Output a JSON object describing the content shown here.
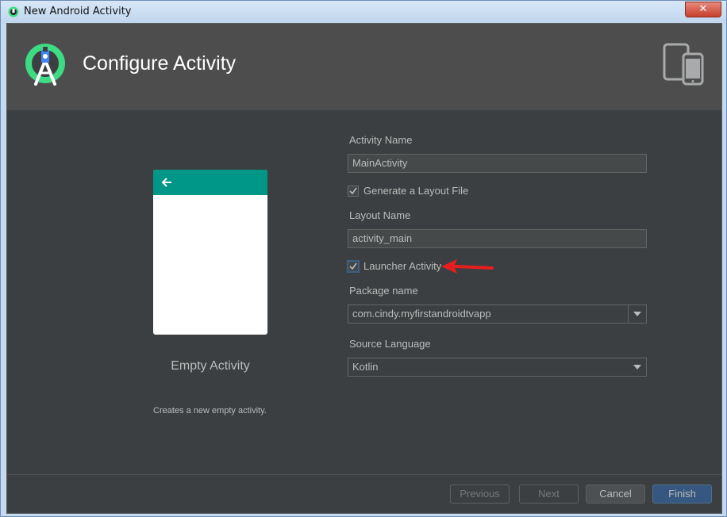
{
  "window": {
    "title": "New Android Activity",
    "close_label": "✕"
  },
  "header": {
    "title": "Configure Activity",
    "logo_icon": "android-studio-logo-icon",
    "devices_icon": "devices-icon"
  },
  "preview": {
    "template_name": "Empty Activity",
    "description": "Creates a new empty activity.",
    "bar_color": "#009688"
  },
  "form": {
    "activity_name_label": "Activity Name",
    "activity_name_value": "MainActivity",
    "generate_layout_label": "Generate a Layout File",
    "generate_layout_checked": true,
    "layout_name_label": "Layout Name",
    "layout_name_value": "activity_main",
    "launcher_activity_label": "Launcher Activity",
    "launcher_activity_checked": true,
    "package_name_label": "Package name",
    "package_name_value": "com.cindy.myfirstandroidtvapp",
    "source_language_label": "Source Language",
    "source_language_value": "Kotlin"
  },
  "buttons": {
    "previous": "Previous",
    "next": "Next",
    "cancel": "Cancel",
    "finish": "Finish"
  },
  "colors": {
    "accent": "#365880",
    "background": "#3c3f41",
    "header": "#4d4d4d",
    "annotation_arrow": "#e81e1e"
  }
}
